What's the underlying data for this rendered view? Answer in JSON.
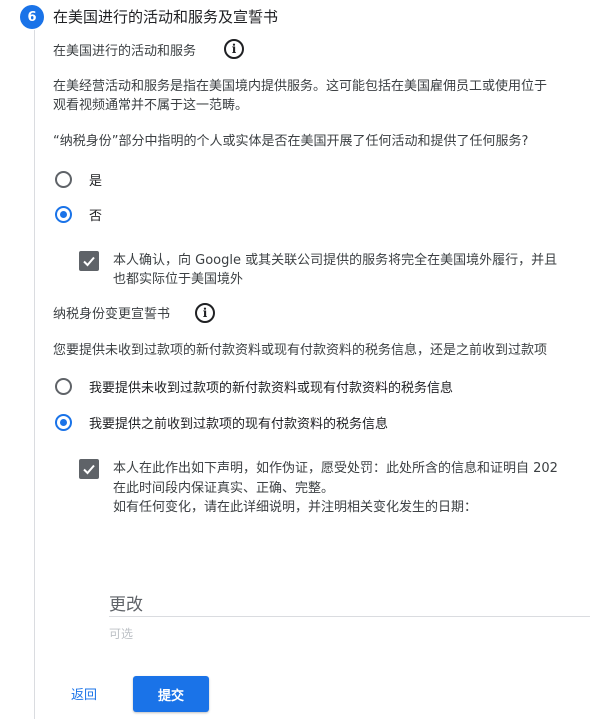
{
  "step": {
    "number": "6",
    "title": "在美国进行的活动和服务及宣誓书"
  },
  "activities": {
    "heading": "在美国进行的活动和服务",
    "desc_line1": "在美经营活动和服务是指在美国境内提供服务。这可能包括在美国雇佣员工或使用位于",
    "desc_line2": "观看视频通常并不属于这一范畴。",
    "question": "“纳税身份”部分中指明的个人或实体是否在美国开展了任何活动和提供了任何服务?",
    "options": [
      {
        "label": "是",
        "selected": false
      },
      {
        "label": "否",
        "selected": true
      }
    ],
    "confirm_line1": "本人确认，向 Google 或其关联公司提供的服务将完全在美国境外履行，并且",
    "confirm_line2": "也都实际位于美国境外",
    "confirm_checked": true
  },
  "tax_change": {
    "heading": "纳税身份变更宣誓书",
    "question": "您要提供未收到过款项的新付款资料或现有付款资料的税务信息，还是之前收到过款项",
    "options": [
      {
        "label": "我要提供未收到过款项的新付款资料或现有付款资料的税务信息",
        "selected": false
      },
      {
        "label": "我要提供之前收到过款项的现有付款资料的税务信息",
        "selected": true
      }
    ],
    "declare_line1": "本人在此作出如下声明，如作伪证，愿受处罚：此处所含的信息和证明自 202",
    "declare_line2": "在此时间段内保证真实、正确、完整。",
    "declare_line3": "如有任何变化，请在此详细说明，并注明相关变化发生的日期：",
    "declare_checked": true
  },
  "changes_field": {
    "label": "更改",
    "hint": "可选"
  },
  "actions": {
    "back": "返回",
    "submit": "提交"
  },
  "colors": {
    "accent": "#1a73e8",
    "checkbox": "#5f6368",
    "divider": "#dadce0"
  }
}
